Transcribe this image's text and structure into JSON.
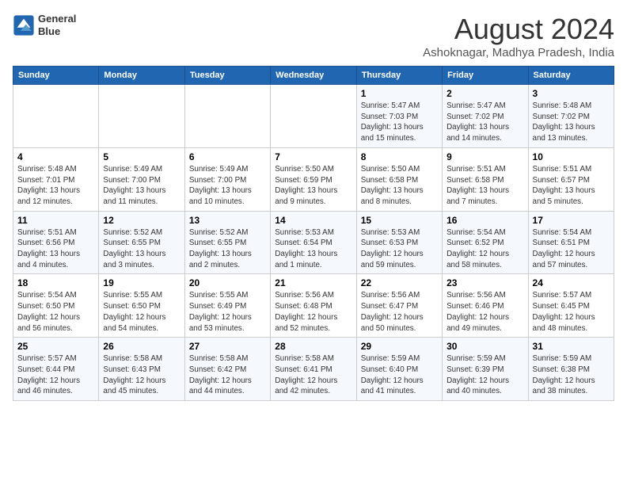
{
  "logo": {
    "line1": "General",
    "line2": "Blue"
  },
  "title": "August 2024",
  "location": "Ashoknagar, Madhya Pradesh, India",
  "days_of_week": [
    "Sunday",
    "Monday",
    "Tuesday",
    "Wednesday",
    "Thursday",
    "Friday",
    "Saturday"
  ],
  "weeks": [
    [
      {
        "day": "",
        "info": ""
      },
      {
        "day": "",
        "info": ""
      },
      {
        "day": "",
        "info": ""
      },
      {
        "day": "",
        "info": ""
      },
      {
        "day": "1",
        "info": "Sunrise: 5:47 AM\nSunset: 7:03 PM\nDaylight: 13 hours\nand 15 minutes."
      },
      {
        "day": "2",
        "info": "Sunrise: 5:47 AM\nSunset: 7:02 PM\nDaylight: 13 hours\nand 14 minutes."
      },
      {
        "day": "3",
        "info": "Sunrise: 5:48 AM\nSunset: 7:02 PM\nDaylight: 13 hours\nand 13 minutes."
      }
    ],
    [
      {
        "day": "4",
        "info": "Sunrise: 5:48 AM\nSunset: 7:01 PM\nDaylight: 13 hours\nand 12 minutes."
      },
      {
        "day": "5",
        "info": "Sunrise: 5:49 AM\nSunset: 7:00 PM\nDaylight: 13 hours\nand 11 minutes."
      },
      {
        "day": "6",
        "info": "Sunrise: 5:49 AM\nSunset: 7:00 PM\nDaylight: 13 hours\nand 10 minutes."
      },
      {
        "day": "7",
        "info": "Sunrise: 5:50 AM\nSunset: 6:59 PM\nDaylight: 13 hours\nand 9 minutes."
      },
      {
        "day": "8",
        "info": "Sunrise: 5:50 AM\nSunset: 6:58 PM\nDaylight: 13 hours\nand 8 minutes."
      },
      {
        "day": "9",
        "info": "Sunrise: 5:51 AM\nSunset: 6:58 PM\nDaylight: 13 hours\nand 7 minutes."
      },
      {
        "day": "10",
        "info": "Sunrise: 5:51 AM\nSunset: 6:57 PM\nDaylight: 13 hours\nand 5 minutes."
      }
    ],
    [
      {
        "day": "11",
        "info": "Sunrise: 5:51 AM\nSunset: 6:56 PM\nDaylight: 13 hours\nand 4 minutes."
      },
      {
        "day": "12",
        "info": "Sunrise: 5:52 AM\nSunset: 6:55 PM\nDaylight: 13 hours\nand 3 minutes."
      },
      {
        "day": "13",
        "info": "Sunrise: 5:52 AM\nSunset: 6:55 PM\nDaylight: 13 hours\nand 2 minutes."
      },
      {
        "day": "14",
        "info": "Sunrise: 5:53 AM\nSunset: 6:54 PM\nDaylight: 13 hours\nand 1 minute."
      },
      {
        "day": "15",
        "info": "Sunrise: 5:53 AM\nSunset: 6:53 PM\nDaylight: 12 hours\nand 59 minutes."
      },
      {
        "day": "16",
        "info": "Sunrise: 5:54 AM\nSunset: 6:52 PM\nDaylight: 12 hours\nand 58 minutes."
      },
      {
        "day": "17",
        "info": "Sunrise: 5:54 AM\nSunset: 6:51 PM\nDaylight: 12 hours\nand 57 minutes."
      }
    ],
    [
      {
        "day": "18",
        "info": "Sunrise: 5:54 AM\nSunset: 6:50 PM\nDaylight: 12 hours\nand 56 minutes."
      },
      {
        "day": "19",
        "info": "Sunrise: 5:55 AM\nSunset: 6:50 PM\nDaylight: 12 hours\nand 54 minutes."
      },
      {
        "day": "20",
        "info": "Sunrise: 5:55 AM\nSunset: 6:49 PM\nDaylight: 12 hours\nand 53 minutes."
      },
      {
        "day": "21",
        "info": "Sunrise: 5:56 AM\nSunset: 6:48 PM\nDaylight: 12 hours\nand 52 minutes."
      },
      {
        "day": "22",
        "info": "Sunrise: 5:56 AM\nSunset: 6:47 PM\nDaylight: 12 hours\nand 50 minutes."
      },
      {
        "day": "23",
        "info": "Sunrise: 5:56 AM\nSunset: 6:46 PM\nDaylight: 12 hours\nand 49 minutes."
      },
      {
        "day": "24",
        "info": "Sunrise: 5:57 AM\nSunset: 6:45 PM\nDaylight: 12 hours\nand 48 minutes."
      }
    ],
    [
      {
        "day": "25",
        "info": "Sunrise: 5:57 AM\nSunset: 6:44 PM\nDaylight: 12 hours\nand 46 minutes."
      },
      {
        "day": "26",
        "info": "Sunrise: 5:58 AM\nSunset: 6:43 PM\nDaylight: 12 hours\nand 45 minutes."
      },
      {
        "day": "27",
        "info": "Sunrise: 5:58 AM\nSunset: 6:42 PM\nDaylight: 12 hours\nand 44 minutes."
      },
      {
        "day": "28",
        "info": "Sunrise: 5:58 AM\nSunset: 6:41 PM\nDaylight: 12 hours\nand 42 minutes."
      },
      {
        "day": "29",
        "info": "Sunrise: 5:59 AM\nSunset: 6:40 PM\nDaylight: 12 hours\nand 41 minutes."
      },
      {
        "day": "30",
        "info": "Sunrise: 5:59 AM\nSunset: 6:39 PM\nDaylight: 12 hours\nand 40 minutes."
      },
      {
        "day": "31",
        "info": "Sunrise: 5:59 AM\nSunset: 6:38 PM\nDaylight: 12 hours\nand 38 minutes."
      }
    ]
  ]
}
